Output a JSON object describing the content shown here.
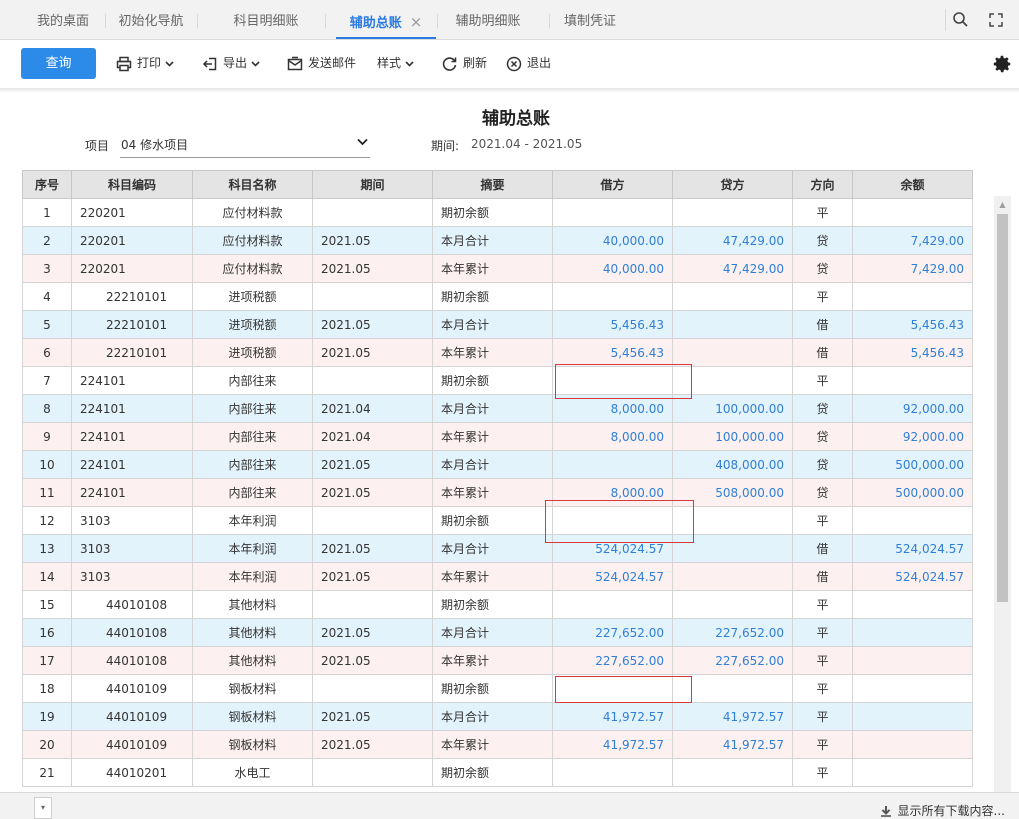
{
  "tabs": [
    {
      "label": "我的桌面"
    },
    {
      "label": "初始化导航"
    },
    {
      "label": "科目明细账"
    },
    {
      "label": "辅助总账",
      "close": "×"
    },
    {
      "label": "辅助明细账"
    },
    {
      "label": "填制凭证"
    }
  ],
  "toolbar": {
    "query": "查询",
    "print": "打印",
    "export": "导出",
    "email": "发送邮件",
    "style": "样式",
    "refresh": "刷新",
    "exit": "退出"
  },
  "page": {
    "title": "辅助总账",
    "project_label": "项目",
    "project_value": "04 修水项目",
    "period_label": "期间:",
    "period_value": "2021.04 - 2021.05"
  },
  "table": {
    "columns": [
      "序号",
      "科目编码",
      "科目名称",
      "期间",
      "摘要",
      "借方",
      "贷方",
      "方向",
      "余额"
    ],
    "rows": [
      {
        "seq": "1",
        "code": "220201",
        "name": "应付材料款",
        "period": "",
        "summary": "期初余额",
        "debit": "",
        "credit": "",
        "dir": "平",
        "balance": "",
        "indent": false,
        "color": "white"
      },
      {
        "seq": "2",
        "code": "220201",
        "name": "应付材料款",
        "period": "2021.05",
        "summary": "本月合计",
        "debit": "40,000.00",
        "credit": "47,429.00",
        "dir": "贷",
        "balance": "7,429.00",
        "indent": false,
        "color": "blue"
      },
      {
        "seq": "3",
        "code": "220201",
        "name": "应付材料款",
        "period": "2021.05",
        "summary": "本年累计",
        "debit": "40,000.00",
        "credit": "47,429.00",
        "dir": "贷",
        "balance": "7,429.00",
        "indent": false,
        "color": "pink"
      },
      {
        "seq": "4",
        "code": "22210101",
        "name": "进项税额",
        "period": "",
        "summary": "期初余额",
        "debit": "",
        "credit": "",
        "dir": "平",
        "balance": "",
        "indent": true,
        "color": "white"
      },
      {
        "seq": "5",
        "code": "22210101",
        "name": "进项税额",
        "period": "2021.05",
        "summary": "本月合计",
        "debit": "5,456.43",
        "credit": "",
        "dir": "借",
        "balance": "5,456.43",
        "indent": true,
        "color": "blue"
      },
      {
        "seq": "6",
        "code": "22210101",
        "name": "进项税额",
        "period": "2021.05",
        "summary": "本年累计",
        "debit": "5,456.43",
        "credit": "",
        "dir": "借",
        "balance": "5,456.43",
        "indent": true,
        "color": "pink"
      },
      {
        "seq": "7",
        "code": "224101",
        "name": "内部往来",
        "period": "",
        "summary": "期初余额",
        "debit": "",
        "credit": "",
        "dir": "平",
        "balance": "",
        "indent": false,
        "color": "white"
      },
      {
        "seq": "8",
        "code": "224101",
        "name": "内部往来",
        "period": "2021.04",
        "summary": "本月合计",
        "debit": "8,000.00",
        "credit": "100,000.00",
        "dir": "贷",
        "balance": "92,000.00",
        "indent": false,
        "color": "blue"
      },
      {
        "seq": "9",
        "code": "224101",
        "name": "内部往来",
        "period": "2021.04",
        "summary": "本年累计",
        "debit": "8,000.00",
        "credit": "100,000.00",
        "dir": "贷",
        "balance": "92,000.00",
        "indent": false,
        "color": "pink"
      },
      {
        "seq": "10",
        "code": "224101",
        "name": "内部往来",
        "period": "2021.05",
        "summary": "本月合计",
        "debit": "",
        "credit": "408,000.00",
        "dir": "贷",
        "balance": "500,000.00",
        "indent": false,
        "color": "blue"
      },
      {
        "seq": "11",
        "code": "224101",
        "name": "内部往来",
        "period": "2021.05",
        "summary": "本年累计",
        "debit": "8,000.00",
        "credit": "508,000.00",
        "dir": "贷",
        "balance": "500,000.00",
        "indent": false,
        "color": "pink"
      },
      {
        "seq": "12",
        "code": "3103",
        "name": "本年利润",
        "period": "",
        "summary": "期初余额",
        "debit": "",
        "credit": "",
        "dir": "平",
        "balance": "",
        "indent": false,
        "color": "white"
      },
      {
        "seq": "13",
        "code": "3103",
        "name": "本年利润",
        "period": "2021.05",
        "summary": "本月合计",
        "debit": "524,024.57",
        "credit": "",
        "dir": "借",
        "balance": "524,024.57",
        "indent": false,
        "color": "blue"
      },
      {
        "seq": "14",
        "code": "3103",
        "name": "本年利润",
        "period": "2021.05",
        "summary": "本年累计",
        "debit": "524,024.57",
        "credit": "",
        "dir": "借",
        "balance": "524,024.57",
        "indent": false,
        "color": "pink"
      },
      {
        "seq": "15",
        "code": "44010108",
        "name": "其他材料",
        "period": "",
        "summary": "期初余额",
        "debit": "",
        "credit": "",
        "dir": "平",
        "balance": "",
        "indent": true,
        "color": "white"
      },
      {
        "seq": "16",
        "code": "44010108",
        "name": "其他材料",
        "period": "2021.05",
        "summary": "本月合计",
        "debit": "227,652.00",
        "credit": "227,652.00",
        "dir": "平",
        "balance": "",
        "indent": true,
        "color": "blue"
      },
      {
        "seq": "17",
        "code": "44010108",
        "name": "其他材料",
        "period": "2021.05",
        "summary": "本年累计",
        "debit": "227,652.00",
        "credit": "227,652.00",
        "dir": "平",
        "balance": "",
        "indent": true,
        "color": "pink"
      },
      {
        "seq": "18",
        "code": "44010109",
        "name": "钢板材料",
        "period": "",
        "summary": "期初余额",
        "debit": "",
        "credit": "",
        "dir": "平",
        "balance": "",
        "indent": true,
        "color": "white"
      },
      {
        "seq": "19",
        "code": "44010109",
        "name": "钢板材料",
        "period": "2021.05",
        "summary": "本月合计",
        "debit": "41,972.57",
        "credit": "41,972.57",
        "dir": "平",
        "balance": "",
        "indent": true,
        "color": "blue"
      },
      {
        "seq": "20",
        "code": "44010109",
        "name": "钢板材料",
        "period": "2021.05",
        "summary": "本年累计",
        "debit": "41,972.57",
        "credit": "41,972.57",
        "dir": "平",
        "balance": "",
        "indent": true,
        "color": "pink"
      },
      {
        "seq": "21",
        "code": "44010201",
        "name": "水电工",
        "period": "",
        "summary": "期初余额",
        "debit": "",
        "credit": "",
        "dir": "平",
        "balance": "",
        "indent": true,
        "color": "white"
      }
    ]
  },
  "downloads": {
    "show_all": "显示所有下载内容..."
  },
  "colors": {
    "accent": "#2c8ae8",
    "number": "#2f7fd8",
    "row_blue": "#e3f3fb",
    "row_pink": "#fcf0f0",
    "highlight_box": "#d43a3a"
  }
}
